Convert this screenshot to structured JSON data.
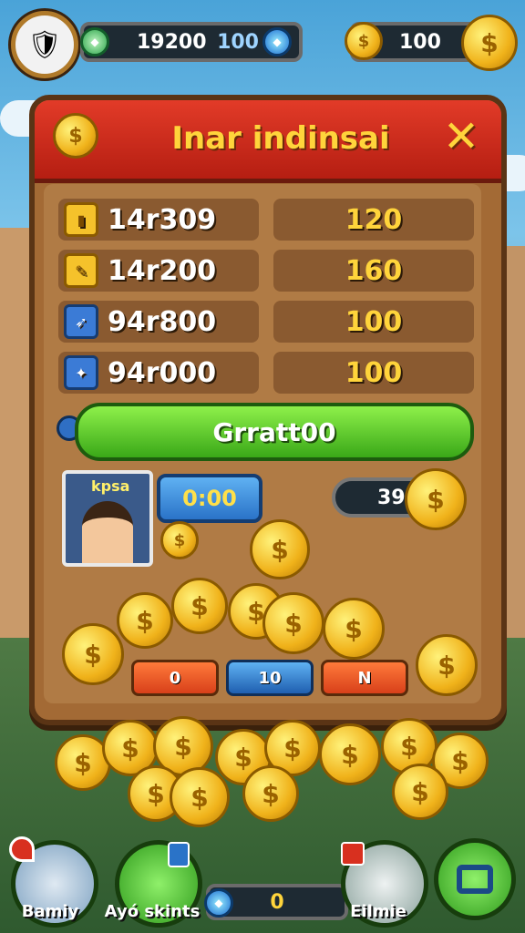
{
  "top": {
    "gem_value": "19200",
    "blue_value": "100",
    "coin_value": "100"
  },
  "panel": {
    "title": "Inar indinsai",
    "close_glyph": "✕",
    "rows": [
      {
        "label": "14r309",
        "value": "120",
        "icon": "card-icon"
      },
      {
        "label": "14r200",
        "value": "160",
        "icon": "tool-icon"
      },
      {
        "label": "94r800",
        "value": "100",
        "icon": "sword-icon"
      },
      {
        "label": "94r000",
        "value": "100",
        "icon": "bag-icon"
      }
    ],
    "action_button": "Grratt00",
    "character_label": "kpsa",
    "timer": "0:00",
    "counter": "39",
    "small_buttons": [
      "0",
      "10",
      "N"
    ]
  },
  "bottom": {
    "left_label": "Bamiy",
    "center_left_label": "Ayó skints",
    "center_value": "0",
    "right_label": "Eilmie"
  },
  "colors": {
    "header_red": "#d8301f",
    "title_yellow": "#ffd43b",
    "panel_brown": "#a36a35",
    "button_green": "#5cc82a"
  }
}
